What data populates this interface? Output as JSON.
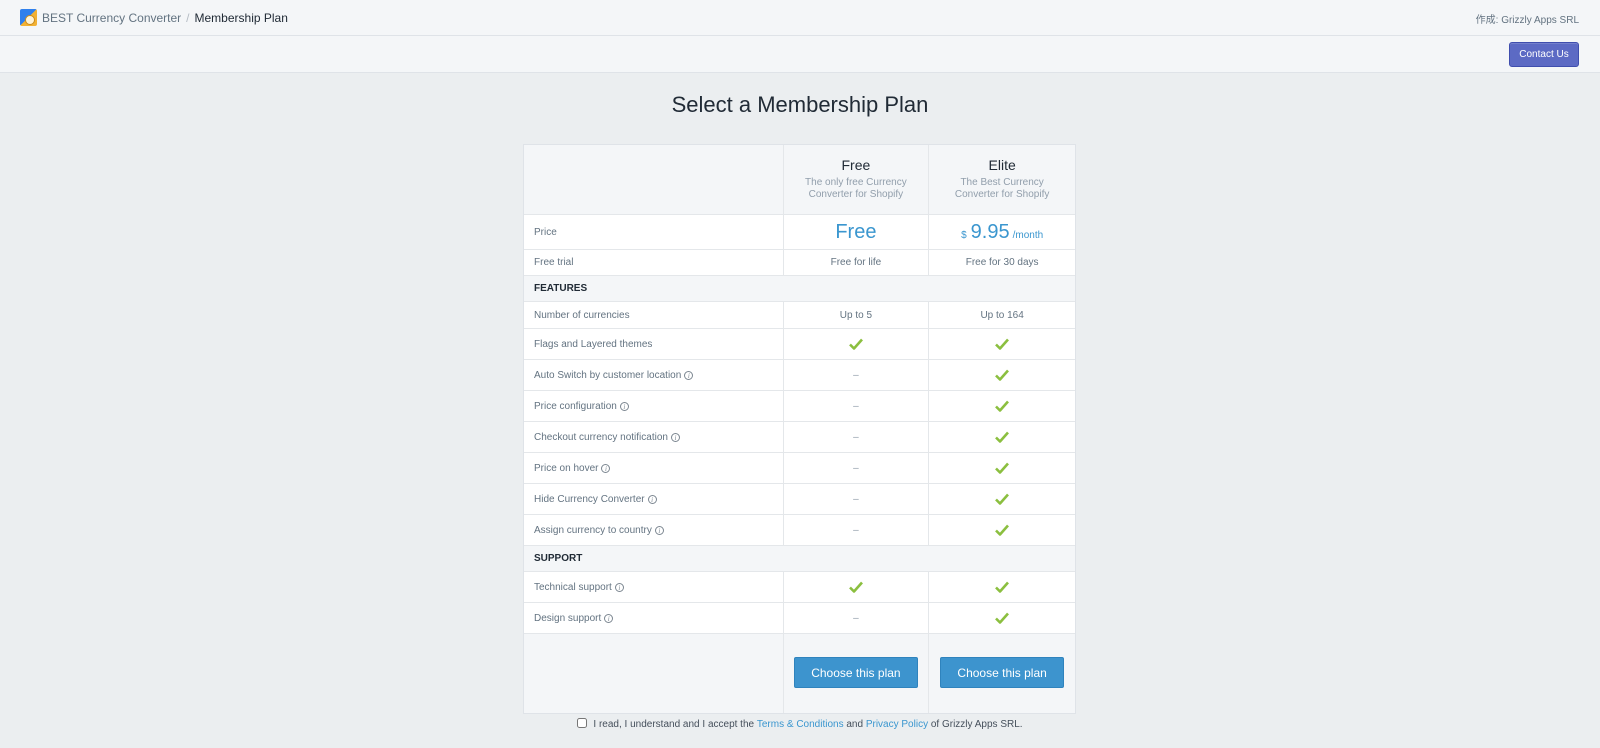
{
  "topbar": {
    "app_name": "BEST Currency Converter",
    "separator": "/",
    "page": "Membership Plan",
    "author": "作成: Grizzly Apps SRL"
  },
  "actions": {
    "contact_label": "Contact Us"
  },
  "title": "Select a Membership Plan",
  "plans": [
    {
      "name": "Free",
      "description": "The only free Currency Converter for Shopify",
      "price": "Free",
      "trial": "Free for life",
      "cta": "Choose this plan"
    },
    {
      "name": "Elite",
      "description": "The Best Currency Converter for Shopify",
      "price_currency": "$",
      "price_amount": "9.95",
      "price_period": "/month",
      "trial": "Free for 30 days",
      "cta": "Choose this plan"
    }
  ],
  "rows": {
    "price_label": "Price",
    "trial_label": "Free trial"
  },
  "features": {
    "heading": "FEATURES",
    "items": [
      {
        "label": "Number of currencies",
        "free": "Up to 5",
        "elite": "Up to 164"
      },
      {
        "label": "Flags and Layered themes",
        "free": "check",
        "elite": "check"
      },
      {
        "label": "Auto Switch by customer location",
        "free": "–",
        "elite": "check"
      },
      {
        "label": "Price configuration",
        "free": "–",
        "elite": "check"
      },
      {
        "label": "Checkout currency notification",
        "free": "–",
        "elite": "check"
      },
      {
        "label": "Price on hover",
        "free": "–",
        "elite": "check"
      },
      {
        "label": "Hide Currency Converter",
        "free": "–",
        "elite": "check"
      },
      {
        "label": "Assign currency to country",
        "free": "–",
        "elite": "check"
      }
    ]
  },
  "support": {
    "heading": "SUPPORT",
    "items": [
      {
        "label": "Technical support",
        "free": "check",
        "elite": "check"
      },
      {
        "label": "Design support",
        "free": "–",
        "elite": "check"
      }
    ]
  },
  "info_glyph": "i",
  "terms": {
    "prefix": "I read, I understand and I accept the ",
    "terms_link": "Terms & Conditions",
    "middle": " and ",
    "privacy_link": "Privacy Policy",
    "suffix": " of Grizzly Apps SRL.",
    "checked": false
  },
  "colors": {
    "accent": "#3a96cf",
    "contact_button": "#5c6ac4",
    "check": "#8bbf3f"
  },
  "icons": {
    "check": "check-icon",
    "info": "info-icon",
    "app": "app-logo-icon"
  }
}
